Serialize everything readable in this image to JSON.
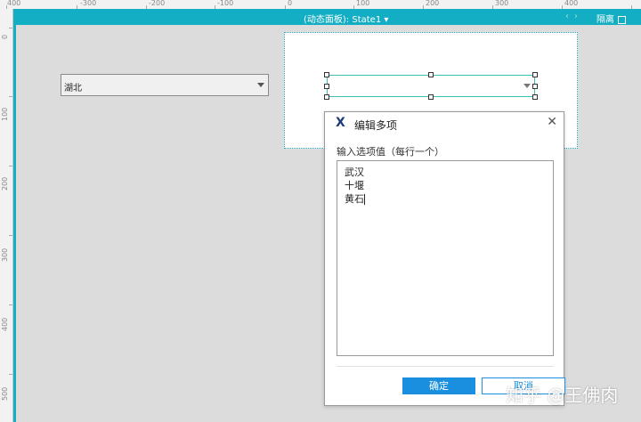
{
  "ruler": {
    "top_labels": [
      "400",
      "-300",
      "-200",
      "-100",
      "0",
      "100",
      "200",
      "300",
      "400"
    ],
    "left_labels": [
      "0",
      "100",
      "200",
      "300",
      "400",
      "500"
    ]
  },
  "state_bar": {
    "title": "(动态面板): State1",
    "isolate_label": "隔离",
    "accent_color": "#13aec3"
  },
  "canvas": {
    "dropdown_value": "湖北"
  },
  "dialog": {
    "title": "编辑多项",
    "label": "输入选项值（每行一个）",
    "options": [
      "武汉",
      "十堰",
      "黄石"
    ],
    "ok_label": "确定",
    "cancel_label": "取消"
  },
  "watermark": "知乎 @王佛肉",
  "icons": {
    "logo": "axure-x-icon",
    "close": "close-icon",
    "arrow": "chevron-down-icon"
  }
}
